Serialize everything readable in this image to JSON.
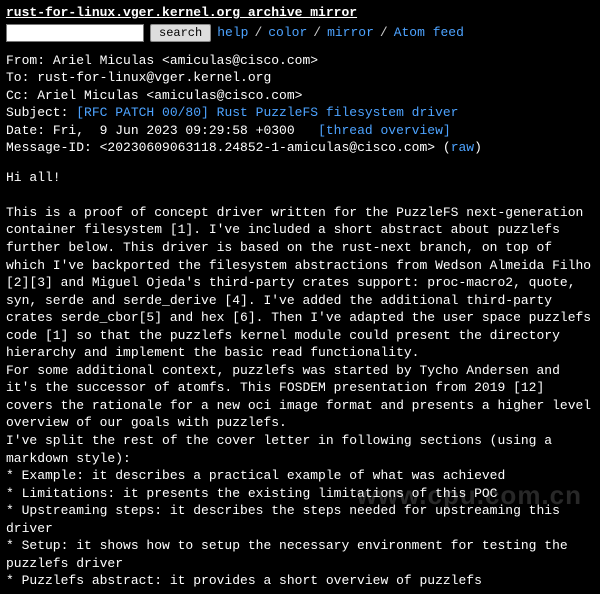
{
  "header": {
    "title": "rust-for-linux.vger.kernel.org archive mirror",
    "search_button": "search",
    "search_value": "",
    "nav": {
      "help": "help",
      "color": "color",
      "mirror": "mirror",
      "atom": "Atom feed"
    }
  },
  "message": {
    "from_label": "From: ",
    "from_value": "Ariel Miculas <amiculas@cisco.com>",
    "to_label": "To: ",
    "to_value": "rust-for-linux@vger.kernel.org",
    "cc_label": "Cc: ",
    "cc_value": "Ariel Miculas <amiculas@cisco.com>",
    "subject_label": "Subject: ",
    "subject_value": "[RFC PATCH 00/80] Rust PuzzleFS filesystem driver",
    "date_label": "Date: ",
    "date_value": "Fri,  9 Jun 2023 09:29:58 +0300   ",
    "thread_overview": "[thread overview]",
    "msgid_label": "Message-ID: ",
    "msgid_value": "<20230609063118.24852-1-amiculas@cisco.com> (",
    "raw_link": "raw",
    "msgid_tail": ")"
  },
  "body": {
    "p1": "Hi all!",
    "p2": "This is a proof of concept driver written for the PuzzleFS next-generation container filesystem [1]. I've included a short abstract about puzzlefs further below. This driver is based on the rust-next branch, on top of which I've backported the filesystem abstractions from Wedson Almeida Filho [2][3] and Miguel Ojeda's third-party crates support: proc-macro2, quote, syn, serde and serde_derive [4]. I've added the additional third-party crates serde_cbor[5] and hex [6]. Then I've adapted the user space puzzlefs code [1] so that the puzzlefs kernel module could present the directory hierarchy and implement the basic read functionality.",
    "p3": "For some additional context, puzzlefs was started by Tycho Andersen and it's the successor of atomfs. This FOSDEM presentation from 2019 [12] covers the rationale for a new oci image format and presents a higher level overview of our goals with puzzlefs.",
    "p4": "I've split the rest of the cover letter in following sections (using a markdown style):",
    "b1": "* Example: it describes a practical example of what was achieved",
    "b2": "* Limitations: it presents the existing limitations of this POC",
    "b3": "* Upstreaming steps: it describes the steps needed for upstreaming this driver",
    "b4": "* Setup: it shows how to setup the necessary environment for testing the puzzlefs driver",
    "b5": "* Puzzlefs abstract: it provides a short overview of puzzlefs"
  },
  "watermark": "www.cpu.com.cn"
}
